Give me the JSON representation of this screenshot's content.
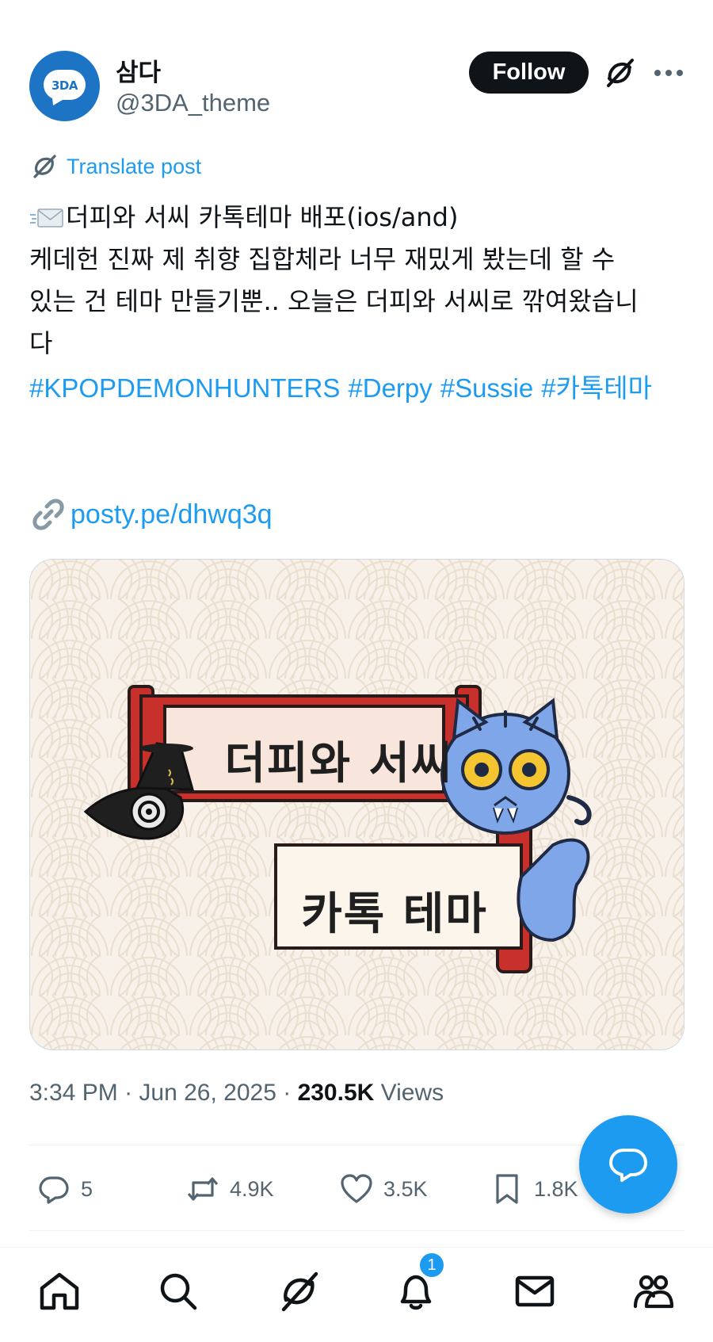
{
  "author": {
    "display_name": "삼다",
    "handle": "@3DA_theme",
    "avatar_text": "3DA"
  },
  "header": {
    "follow_label": "Follow"
  },
  "post": {
    "translate_label": "Translate post",
    "lines": [
      "더피와 서씨 카톡테마 배포(ios/and)",
      "케데헌 진짜 제 취향 집합체라 너무 재밌게 봤는데 할 수",
      "있는 건 테마 만들기뿐.. 오늘은 더피와 서씨로 깎여왔습니",
      "다"
    ],
    "hashtags": [
      "#KPOPDEMONHUNTERS",
      "#Derpy",
      "#Sussie",
      "#카톡테마"
    ],
    "link": "posty.pe/dhwq3q",
    "image": {
      "title_line1": "더피와 서씨",
      "title_line2": "카톡 테마"
    },
    "time": "3:34 PM",
    "date": "Jun 26, 2025",
    "views_count": "230.5K",
    "views_label": "Views"
  },
  "actions": {
    "replies": "5",
    "reposts": "4.9K",
    "likes": "3.5K",
    "bookmarks": "1.8K"
  },
  "bottom_nav": {
    "notifications_badge": "1"
  },
  "colors": {
    "accent": "#1d9bf0",
    "text": "#0f1419",
    "muted": "#536471",
    "avatar": "#1d73c4"
  }
}
